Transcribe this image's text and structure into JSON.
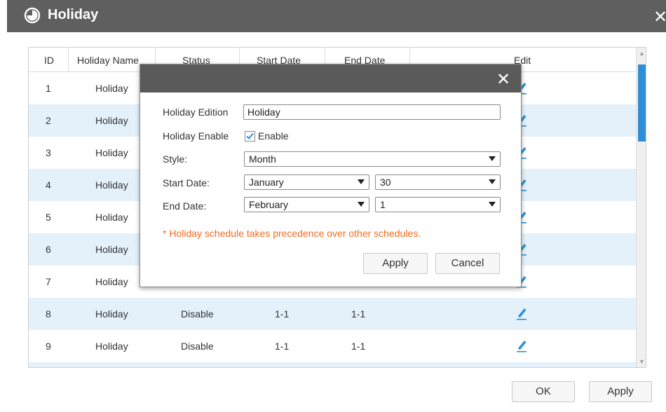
{
  "window": {
    "title": "Holiday",
    "close_glyph": "✕",
    "icon": "clock-icon"
  },
  "table": {
    "columns": [
      "ID",
      "Holiday Name",
      "Status",
      "Start Date",
      "End Date",
      "Edit"
    ],
    "rows": [
      {
        "id": "1",
        "name": "Holiday",
        "status": "",
        "start": "",
        "end": ""
      },
      {
        "id": "2",
        "name": "Holiday",
        "status": "",
        "start": "",
        "end": ""
      },
      {
        "id": "3",
        "name": "Holiday",
        "status": "",
        "start": "",
        "end": ""
      },
      {
        "id": "4",
        "name": "Holiday",
        "status": "",
        "start": "",
        "end": ""
      },
      {
        "id": "5",
        "name": "Holiday",
        "status": "",
        "start": "",
        "end": ""
      },
      {
        "id": "6",
        "name": "Holiday",
        "status": "",
        "start": "",
        "end": ""
      },
      {
        "id": "7",
        "name": "Holiday",
        "status": "",
        "start": "",
        "end": ""
      },
      {
        "id": "8",
        "name": "Holiday",
        "status": "Disable",
        "start": "1-1",
        "end": "1-1"
      },
      {
        "id": "9",
        "name": "Holiday",
        "status": "Disable",
        "start": "1-1",
        "end": "1-1"
      }
    ],
    "edit_icon": "pencil-icon",
    "accent": "#2f8fd6",
    "alt_row_color": "#e4f1fb"
  },
  "footer": {
    "ok_label": "OK",
    "apply_label": "Apply"
  },
  "dialog": {
    "close_glyph": "✕",
    "holiday_edition_label": "Holiday Edition",
    "holiday_edition_value": "Holiday",
    "holiday_enable_label": "Holiday Enable",
    "enable_label": "Enable",
    "enable_checked": true,
    "style_label": "Style:",
    "style_value": "Month",
    "start_date_label": "Start Date:",
    "start_month": "January",
    "start_day": "30",
    "end_date_label": "End Date:",
    "end_month": "February",
    "end_day": "1",
    "note": "* Holiday schedule takes precedence over other schedules.",
    "note_color": "#f26b21",
    "apply_label": "Apply",
    "cancel_label": "Cancel"
  }
}
